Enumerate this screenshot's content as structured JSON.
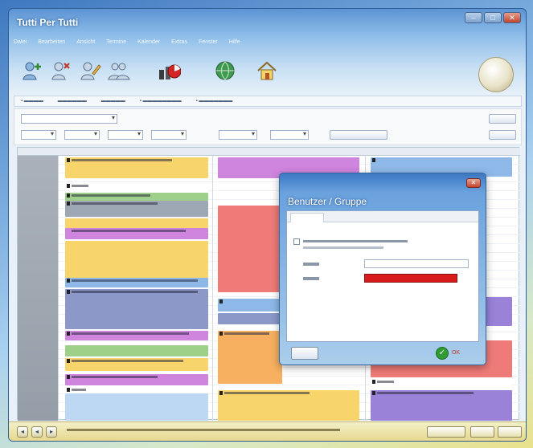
{
  "window": {
    "title": "Tutti Per Tutti",
    "controls": {
      "min": "–",
      "max": "□",
      "close": "✕"
    }
  },
  "menu": {
    "items": [
      "Datei",
      "Bearbeiten",
      "Ansicht",
      "Termine",
      "Kalender",
      "Extras",
      "Fenster",
      "Hilfe"
    ]
  },
  "toolbar": {
    "icons": [
      "user-plus-icon",
      "user-remove-icon",
      "user-edit-icon",
      "user-group-icon",
      "chart-icon",
      "globe-icon",
      "home-icon"
    ]
  },
  "colors": {
    "yellow": "#f7d56a",
    "purple": "#cf84de",
    "blue": "#8eb8e8",
    "gray": "#9ea7b4",
    "green": "#9ed08a",
    "red": "#ef7b78",
    "orange": "#f6b05f",
    "violet": "#9a82d9",
    "lightblue": "#bcd8f3",
    "slate": "#8b98c8"
  },
  "dialog": {
    "title": "Benutzer / Gruppe",
    "ok_label": "OK"
  }
}
